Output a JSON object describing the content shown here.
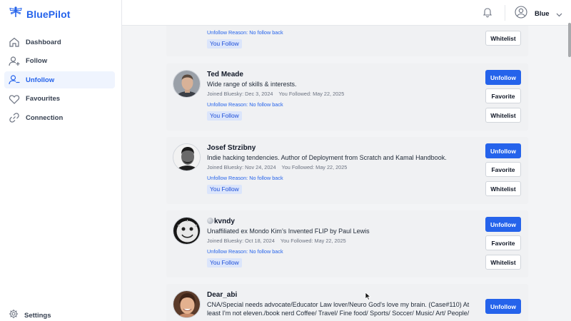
{
  "app": {
    "brand": "BluePilot",
    "accent": "#2563eb"
  },
  "sidebar": {
    "items": [
      {
        "label": "Dashboard",
        "icon": "home-icon"
      },
      {
        "label": "Follow",
        "icon": "user-plus-icon"
      },
      {
        "label": "Unfollow",
        "icon": "user-minus-icon",
        "active": true
      },
      {
        "label": "Favourites",
        "icon": "heart-icon"
      },
      {
        "label": "Connection",
        "icon": "link-icon"
      }
    ],
    "settings_label": "Settings"
  },
  "header": {
    "user_name": "Blue"
  },
  "cards": [
    {
      "reason": "Unfollow Reason: No follow back",
      "tag": "You Follow",
      "buttons": {
        "whitelist": "Whitelist"
      }
    },
    {
      "name": "Ted Meade",
      "bio": "Wide range of skills & interests.",
      "joined": "Joined Bluesky: Dec 3, 2024",
      "followed": "You Followed: May 22, 2025",
      "reason": "Unfollow Reason: No follow back",
      "tag": "You Follow",
      "buttons": {
        "unfollow": "Unfollow",
        "favorite": "Favorite",
        "whitelist": "Whitelist"
      }
    },
    {
      "name": "Josef Strzibny",
      "bio": "Indie hacking tendencies. Author of Deployment from Scratch and Kamal Handbook.",
      "joined": "Joined Bluesky: Nov 24, 2024",
      "followed": "You Followed: May 22, 2025",
      "reason": "Unfollow Reason: No follow back",
      "tag": "You Follow",
      "buttons": {
        "unfollow": "Unfollow",
        "favorite": "Favorite",
        "whitelist": "Whitelist"
      }
    },
    {
      "name": "kvndy",
      "bio": "Unaffiliated ex Mondo Kim’s Invented FLIP by Paul Lewis",
      "joined": "Joined Bluesky: Oct 18, 2024",
      "followed": "You Followed: May 22, 2025",
      "reason": "Unfollow Reason: No follow back",
      "tag": "You Follow",
      "buttons": {
        "unfollow": "Unfollow",
        "favorite": "Favorite",
        "whitelist": "Whitelist"
      }
    },
    {
      "name": "Dear_abi",
      "bio": "CNA/Special needs advocate/Educator Law lover/Neuro God's love my brain. (Case#110) At least I'm not eleven./book nerd Coffee/ Travel/ Fine food/ Sports/ Soccer/ Music/ Art/ People/",
      "buttons": {
        "unfollow": "Unfollow"
      }
    }
  ]
}
